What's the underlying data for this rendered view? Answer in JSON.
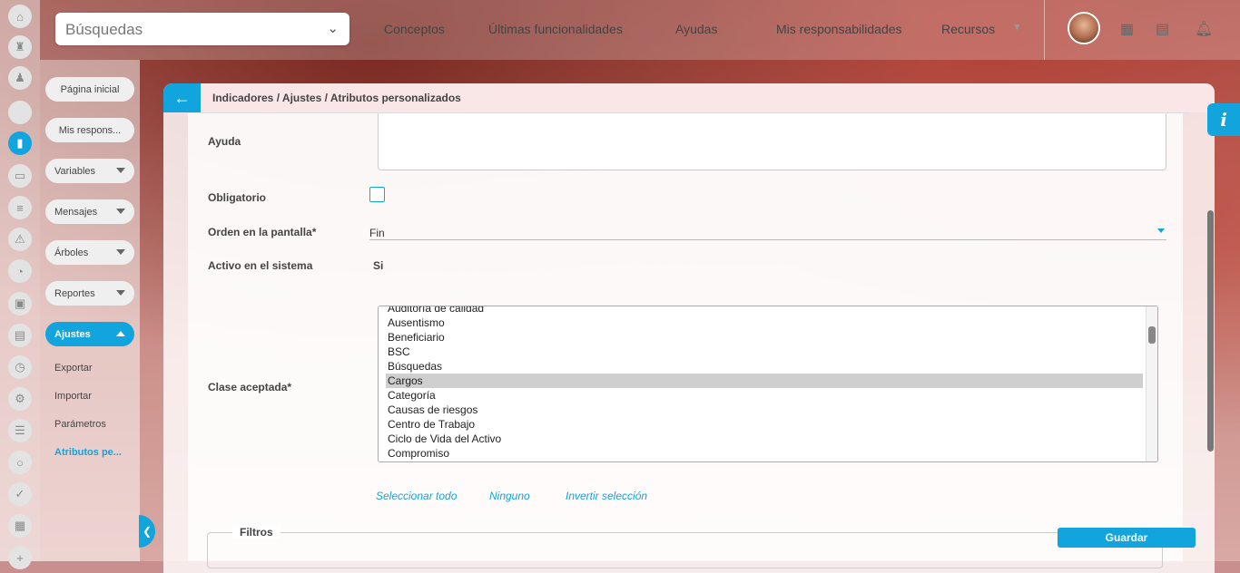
{
  "colors": {
    "accent": "#12a4dd",
    "selected_row": "#cfcfcf"
  },
  "rail": {
    "icons": [
      "home-icon",
      "chess-rook-icon",
      "pawn-icon",
      "blank-icon",
      "bar-chart-icon",
      "monitor-icon",
      "tasks-icon",
      "warning-icon",
      "pie-chart-icon",
      "briefcase-icon",
      "map-icon",
      "clock-icon",
      "gear-icon",
      "list-icon",
      "cycle-icon",
      "check-icon",
      "calendar-icon",
      "plus-icon"
    ]
  },
  "search": {
    "placeholder": "Búsquedas"
  },
  "nav": {
    "items": [
      {
        "label": "Conceptos"
      },
      {
        "label": "Últimas funcionalidades"
      },
      {
        "label": "Ayudas"
      },
      {
        "label": "Mis responsabilidades"
      },
      {
        "label": "Recursos"
      }
    ]
  },
  "sidebar": {
    "home": "Página inicial",
    "myresp": "Mis respons...",
    "variables": "Variables",
    "mensajes": "Mensajes",
    "arboles": "Árboles",
    "reportes": "Reportes",
    "ajustes": "Ajustes",
    "sub": {
      "exportar": "Exportar",
      "importar": "Importar",
      "parametros": "Parámetros",
      "atributos": "Atributos pe..."
    }
  },
  "header": {
    "breadcrumb": "Indicadores / Ajustes / Atributos personalizados"
  },
  "form": {
    "ayuda_label": "Ayuda",
    "obligatorio_label": "Obligatorio",
    "orden_label": "Orden en la pantalla*",
    "orden_value": "Fin",
    "activo_label": "Activo en el sistema",
    "activo_value": "Si",
    "clase_label": "Clase aceptada*",
    "clase_options": [
      {
        "label": "Auditoría de calidad",
        "selected": false
      },
      {
        "label": "Ausentismo",
        "selected": false
      },
      {
        "label": "Beneficiario",
        "selected": false
      },
      {
        "label": "BSC",
        "selected": false
      },
      {
        "label": "Búsquedas",
        "selected": false
      },
      {
        "label": "Cargos",
        "selected": true
      },
      {
        "label": "Categoría",
        "selected": false
      },
      {
        "label": "Causas de riesgos",
        "selected": false
      },
      {
        "label": "Centro de Trabajo",
        "selected": false
      },
      {
        "label": "Ciclo de Vida del Activo",
        "selected": false
      },
      {
        "label": "Compromiso",
        "selected": false
      }
    ],
    "select_all": "Seleccionar todo",
    "none": "Ninguno",
    "invert": "Invertir selección",
    "filtros_label": "Filtros",
    "save_label": "Guardar"
  },
  "info_label": "i"
}
